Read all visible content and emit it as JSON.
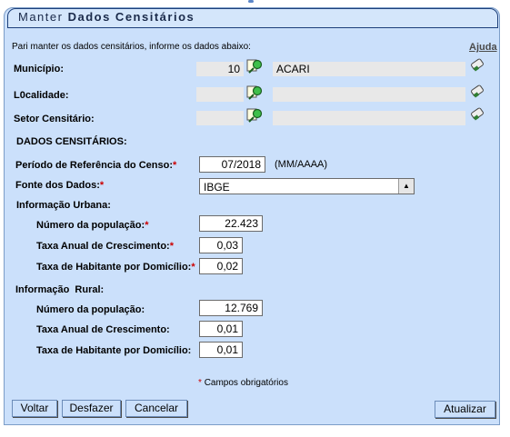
{
  "form": {
    "title_prefix": "Manter",
    "title_bold": "Dados Censitários",
    "instruction": "Pari manter os dados censitários, informe os dados abaixo:",
    "help_link": "Ajuda",
    "municipio_label": "Município:",
    "municipio_code": "10",
    "municipio_name": "ACARI",
    "localidade_label": "L0calidade:",
    "localidade_code": "",
    "localidade_name": "",
    "setor_label": "Setor Censitário:",
    "setor_code": "",
    "setor_name": "",
    "section_heading": "DADOS CENSITÁRIOS:",
    "periodo_label": "Período de Referência do Censo:",
    "periodo_value": "07/2018",
    "periodo_hint": "(MM/AAAA)",
    "fonte_label": "Fonte dos Dados:",
    "fonte_value": "IBGE",
    "required_mark": "*",
    "urbana": {
      "heading": "Informação Urbana:",
      "populacao_label": "Número da população:",
      "populacao_value": "22.423",
      "taxa_crescimento_label": "Taxa Anual de Crescimento:",
      "taxa_crescimento_value": "0,03",
      "taxa_habitante_label": "Taxa de Habitante por Domicílio:",
      "taxa_habitante_value": "0,02"
    },
    "rural": {
      "heading_a": "Informação",
      "heading_b": "Rural:",
      "populacao_label": "Número da população:",
      "populacao_value": "12.769",
      "taxa_crescimento_label": "Taxa Anual de Crescimento:",
      "taxa_crescimento_value": "0,01",
      "taxa_habitante_label": "Taxa de Habitante por Domicílio:",
      "taxa_habitante_value": "0,01"
    },
    "required_note": "Campos obrigatórios"
  },
  "buttons": {
    "voltar": "Voltar",
    "desfazer": "Desfazer",
    "cancelar": "Cancelar",
    "atualizar": "Atualizar"
  },
  "icons": {
    "search": "magnifier-search-icon",
    "clear": "eraser-icon",
    "dropdown": "triangle-up-icon"
  },
  "colors": {
    "panel": "#cbe0fb",
    "border": "#1d3f7a",
    "required": "#cc0000"
  }
}
